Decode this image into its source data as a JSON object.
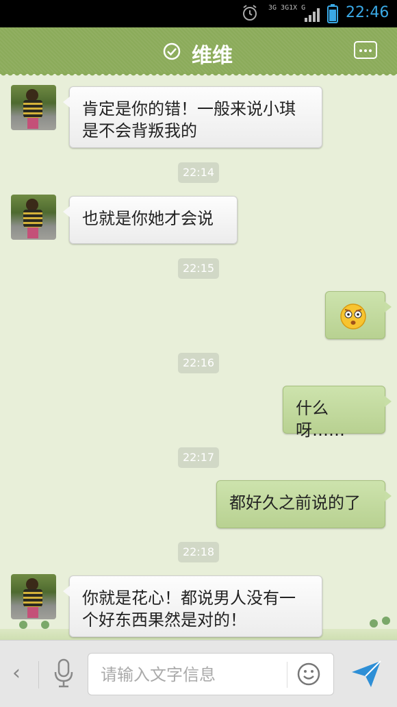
{
  "status_bar": {
    "time": "22:46",
    "network_text": "3G 3G1X G",
    "icons": [
      "alarm-icon",
      "network-icon",
      "signal-icon",
      "battery-icon"
    ],
    "accent_color": "#3aa9e6"
  },
  "header": {
    "title": "维维",
    "icons": [
      "check-circle-icon",
      "more-options-icon"
    ],
    "color": "#8bab5a"
  },
  "messages": [
    {
      "side": "left",
      "text": "肯定是你的错！一般来说小琪是不会背叛我的"
    },
    {
      "type": "time",
      "text": "22:14"
    },
    {
      "side": "left",
      "text": "也就是你她才会说"
    },
    {
      "type": "time",
      "text": "22:15"
    },
    {
      "side": "right",
      "emoji": "shocked-face-emoji"
    },
    {
      "type": "time",
      "text": "22:16"
    },
    {
      "side": "right",
      "text": "什么呀……"
    },
    {
      "type": "time",
      "text": "22:17"
    },
    {
      "side": "right",
      "text": "都好久之前说的了"
    },
    {
      "type": "time",
      "text": "22:18"
    },
    {
      "side": "left",
      "text": "你就是花心！都说男人没有一个好东西果然是对的！"
    }
  ],
  "input_bar": {
    "placeholder": "请输入文字信息",
    "value": "",
    "icons": [
      "back-chevron-icon",
      "microphone-icon",
      "smiley-icon",
      "send-icon"
    ]
  }
}
